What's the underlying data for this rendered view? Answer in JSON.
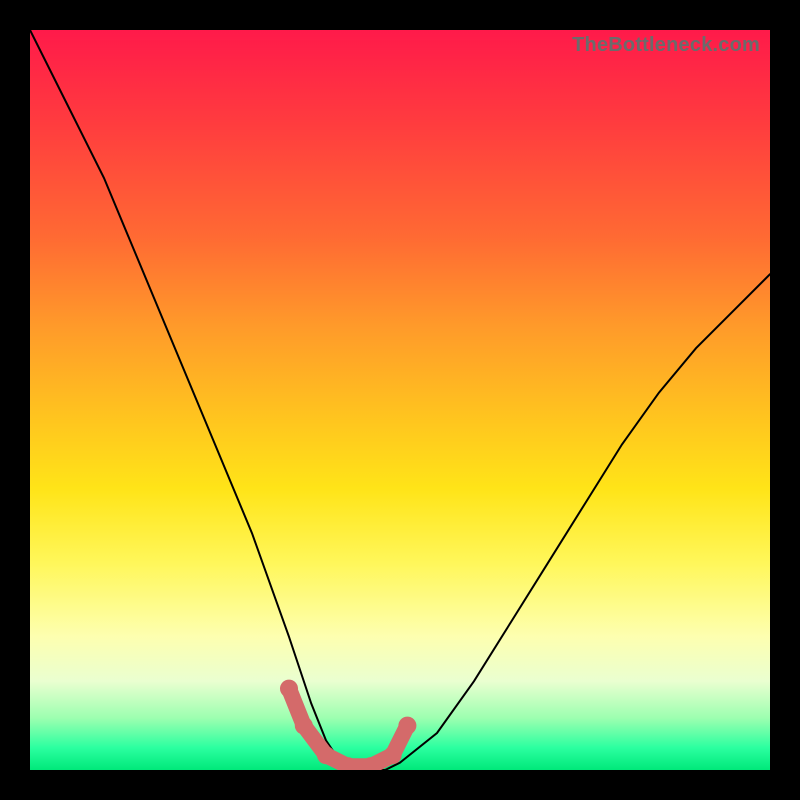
{
  "watermark": "TheBottleneck.com",
  "colors": {
    "background": "#000000",
    "gradient_top": "#ff1a4a",
    "gradient_bottom": "#00e97a",
    "curve": "#000000",
    "marker": "#d46a6a"
  },
  "chart_data": {
    "type": "line",
    "title": "",
    "xlabel": "",
    "ylabel": "",
    "xlim": [
      0,
      100
    ],
    "ylim": [
      0,
      100
    ],
    "grid": false,
    "legend": false,
    "series": [
      {
        "name": "bottleneck-curve",
        "x": [
          0,
          5,
          10,
          15,
          20,
          25,
          30,
          35,
          38,
          40,
          42,
          45,
          48,
          50,
          55,
          60,
          65,
          70,
          75,
          80,
          85,
          90,
          95,
          100
        ],
        "y": [
          100,
          90,
          80,
          68,
          56,
          44,
          32,
          18,
          9,
          4,
          1,
          0,
          0,
          1,
          5,
          12,
          20,
          28,
          36,
          44,
          51,
          57,
          62,
          67
        ]
      }
    ],
    "trough_markers": {
      "x": [
        35,
        37,
        40,
        43,
        46,
        49,
        51
      ],
      "y": [
        11,
        6,
        2,
        0.5,
        0.5,
        2,
        6
      ]
    },
    "annotations": [
      {
        "text": "TheBottleneck.com",
        "position": "top-right"
      }
    ]
  }
}
